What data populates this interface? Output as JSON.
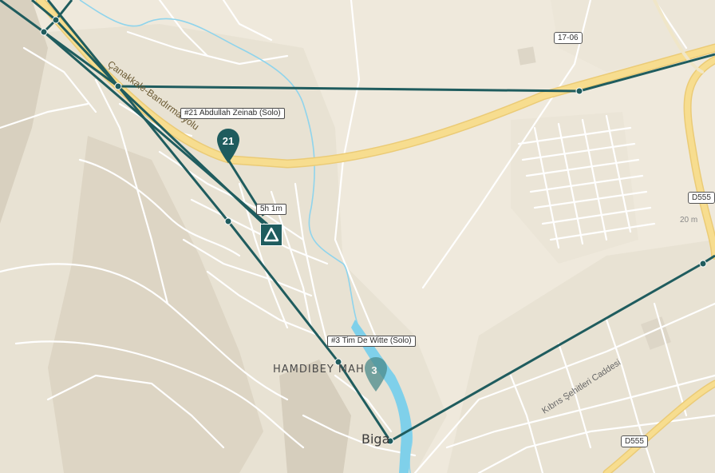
{
  "map": {
    "colors": {
      "land": "#efe9dc",
      "urban": "#e7e1d2",
      "hills": "#d9d2c1",
      "street": "#ffffff",
      "highway": "#f7dd8f",
      "highway_edge": "#ebcb76",
      "river": "#7fd0ea",
      "route": "#1f5c5e"
    },
    "road_shields": {
      "r1706": "17-06",
      "d555_east": "D555",
      "d555_south": "D555"
    },
    "road_names": {
      "canakkale_bandirma": "Çanakkale-Bandırma yolu",
      "kibris": "Kıbrıs Şehitleri Caddesi"
    },
    "elevation": "20 m",
    "places": {
      "hamdibey": "HAMDIBEY MAH",
      "biga": "Biga"
    },
    "labels": {
      "rider21": "#21 Abdullah Zeinab (Solo)",
      "rider3": "#3 Tim De Witte (Solo)",
      "time": "5h 1m"
    },
    "markers": {
      "pin21_number": "21",
      "pin3_number": "3",
      "camp_icon": "campsite-tent-icon"
    }
  }
}
